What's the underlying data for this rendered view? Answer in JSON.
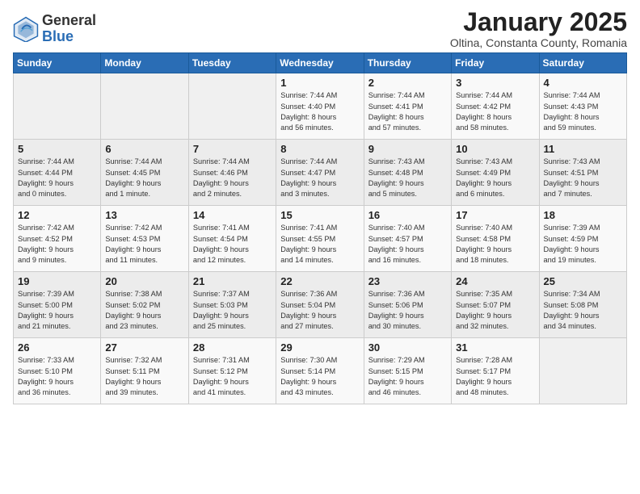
{
  "header": {
    "logo_general": "General",
    "logo_blue": "Blue",
    "month_title": "January 2025",
    "subtitle": "Oltina, Constanta County, Romania"
  },
  "weekdays": [
    "Sunday",
    "Monday",
    "Tuesday",
    "Wednesday",
    "Thursday",
    "Friday",
    "Saturday"
  ],
  "weeks": [
    [
      {
        "day": "",
        "info": ""
      },
      {
        "day": "",
        "info": ""
      },
      {
        "day": "",
        "info": ""
      },
      {
        "day": "1",
        "info": "Sunrise: 7:44 AM\nSunset: 4:40 PM\nDaylight: 8 hours\nand 56 minutes."
      },
      {
        "day": "2",
        "info": "Sunrise: 7:44 AM\nSunset: 4:41 PM\nDaylight: 8 hours\nand 57 minutes."
      },
      {
        "day": "3",
        "info": "Sunrise: 7:44 AM\nSunset: 4:42 PM\nDaylight: 8 hours\nand 58 minutes."
      },
      {
        "day": "4",
        "info": "Sunrise: 7:44 AM\nSunset: 4:43 PM\nDaylight: 8 hours\nand 59 minutes."
      }
    ],
    [
      {
        "day": "5",
        "info": "Sunrise: 7:44 AM\nSunset: 4:44 PM\nDaylight: 9 hours\nand 0 minutes."
      },
      {
        "day": "6",
        "info": "Sunrise: 7:44 AM\nSunset: 4:45 PM\nDaylight: 9 hours\nand 1 minute."
      },
      {
        "day": "7",
        "info": "Sunrise: 7:44 AM\nSunset: 4:46 PM\nDaylight: 9 hours\nand 2 minutes."
      },
      {
        "day": "8",
        "info": "Sunrise: 7:44 AM\nSunset: 4:47 PM\nDaylight: 9 hours\nand 3 minutes."
      },
      {
        "day": "9",
        "info": "Sunrise: 7:43 AM\nSunset: 4:48 PM\nDaylight: 9 hours\nand 5 minutes."
      },
      {
        "day": "10",
        "info": "Sunrise: 7:43 AM\nSunset: 4:49 PM\nDaylight: 9 hours\nand 6 minutes."
      },
      {
        "day": "11",
        "info": "Sunrise: 7:43 AM\nSunset: 4:51 PM\nDaylight: 9 hours\nand 7 minutes."
      }
    ],
    [
      {
        "day": "12",
        "info": "Sunrise: 7:42 AM\nSunset: 4:52 PM\nDaylight: 9 hours\nand 9 minutes."
      },
      {
        "day": "13",
        "info": "Sunrise: 7:42 AM\nSunset: 4:53 PM\nDaylight: 9 hours\nand 11 minutes."
      },
      {
        "day": "14",
        "info": "Sunrise: 7:41 AM\nSunset: 4:54 PM\nDaylight: 9 hours\nand 12 minutes."
      },
      {
        "day": "15",
        "info": "Sunrise: 7:41 AM\nSunset: 4:55 PM\nDaylight: 9 hours\nand 14 minutes."
      },
      {
        "day": "16",
        "info": "Sunrise: 7:40 AM\nSunset: 4:57 PM\nDaylight: 9 hours\nand 16 minutes."
      },
      {
        "day": "17",
        "info": "Sunrise: 7:40 AM\nSunset: 4:58 PM\nDaylight: 9 hours\nand 18 minutes."
      },
      {
        "day": "18",
        "info": "Sunrise: 7:39 AM\nSunset: 4:59 PM\nDaylight: 9 hours\nand 19 minutes."
      }
    ],
    [
      {
        "day": "19",
        "info": "Sunrise: 7:39 AM\nSunset: 5:00 PM\nDaylight: 9 hours\nand 21 minutes."
      },
      {
        "day": "20",
        "info": "Sunrise: 7:38 AM\nSunset: 5:02 PM\nDaylight: 9 hours\nand 23 minutes."
      },
      {
        "day": "21",
        "info": "Sunrise: 7:37 AM\nSunset: 5:03 PM\nDaylight: 9 hours\nand 25 minutes."
      },
      {
        "day": "22",
        "info": "Sunrise: 7:36 AM\nSunset: 5:04 PM\nDaylight: 9 hours\nand 27 minutes."
      },
      {
        "day": "23",
        "info": "Sunrise: 7:36 AM\nSunset: 5:06 PM\nDaylight: 9 hours\nand 30 minutes."
      },
      {
        "day": "24",
        "info": "Sunrise: 7:35 AM\nSunset: 5:07 PM\nDaylight: 9 hours\nand 32 minutes."
      },
      {
        "day": "25",
        "info": "Sunrise: 7:34 AM\nSunset: 5:08 PM\nDaylight: 9 hours\nand 34 minutes."
      }
    ],
    [
      {
        "day": "26",
        "info": "Sunrise: 7:33 AM\nSunset: 5:10 PM\nDaylight: 9 hours\nand 36 minutes."
      },
      {
        "day": "27",
        "info": "Sunrise: 7:32 AM\nSunset: 5:11 PM\nDaylight: 9 hours\nand 39 minutes."
      },
      {
        "day": "28",
        "info": "Sunrise: 7:31 AM\nSunset: 5:12 PM\nDaylight: 9 hours\nand 41 minutes."
      },
      {
        "day": "29",
        "info": "Sunrise: 7:30 AM\nSunset: 5:14 PM\nDaylight: 9 hours\nand 43 minutes."
      },
      {
        "day": "30",
        "info": "Sunrise: 7:29 AM\nSunset: 5:15 PM\nDaylight: 9 hours\nand 46 minutes."
      },
      {
        "day": "31",
        "info": "Sunrise: 7:28 AM\nSunset: 5:17 PM\nDaylight: 9 hours\nand 48 minutes."
      },
      {
        "day": "",
        "info": ""
      }
    ]
  ]
}
